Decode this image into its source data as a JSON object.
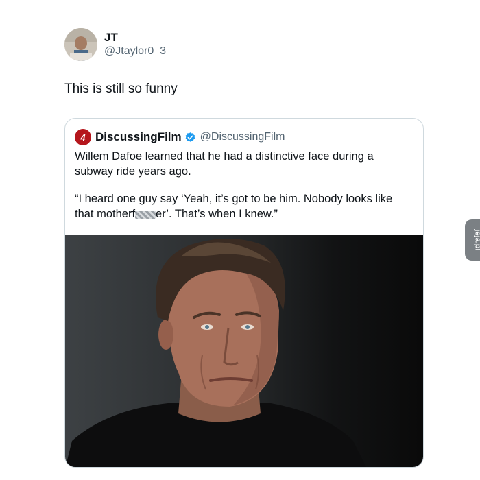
{
  "tweet": {
    "author": {
      "display_name": "JT",
      "handle": "@Jtaylor0_3"
    },
    "text": "This is still so funny"
  },
  "quoted_tweet": {
    "logo_text": "4",
    "logo_color": "#b5161c",
    "display_name": "DiscussingFilm",
    "handle": "@DiscussingFilm",
    "verified": true,
    "paragraph_1": "Willem Dafoe learned that he had a distinctive face during a subway ride years ago.",
    "paragraph_2_before": "“I heard one guy say ‘Yeah, it’s got to be him. Nobody looks like that motherf",
    "paragraph_2_after": "er’. That’s when I knew.”",
    "image": "portrait-photo"
  },
  "watermark": {
    "text": "jeja.pl"
  },
  "colors": {
    "text_primary": "#0f1419",
    "text_secondary": "#536471",
    "verified_blue": "#1d9bf0",
    "card_border": "#cfd9de"
  }
}
